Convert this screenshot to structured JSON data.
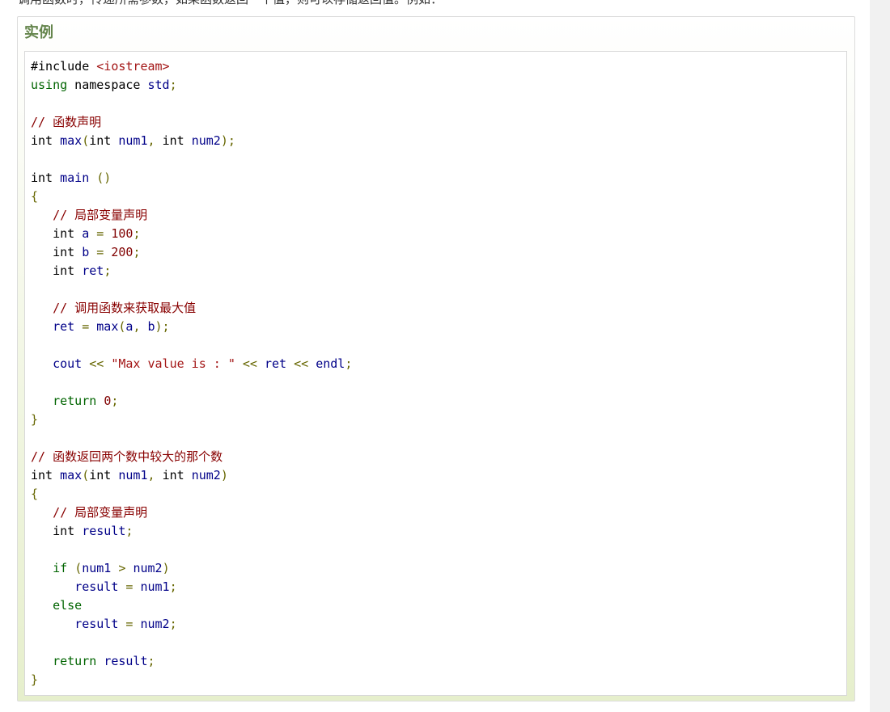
{
  "intro_text": "调用函数时，传递所需参数，如果函数返回一个值，则可以存储返回值。例如：",
  "example": {
    "title": "实例",
    "code_lines": [
      [
        {
          "t": "pre",
          "v": "#include "
        },
        {
          "t": "include",
          "v": "<iostream>"
        }
      ],
      [
        {
          "t": "keyword",
          "v": "using"
        },
        {
          "t": "plain",
          "v": " namespace "
        },
        {
          "t": "ident",
          "v": "std"
        },
        {
          "t": "punct",
          "v": ";"
        }
      ],
      [],
      [
        {
          "t": "comment",
          "v": "// 函数声明"
        }
      ],
      [
        {
          "t": "plain",
          "v": "int "
        },
        {
          "t": "ident",
          "v": "max"
        },
        {
          "t": "punct",
          "v": "("
        },
        {
          "t": "plain",
          "v": "int "
        },
        {
          "t": "ident",
          "v": "num1"
        },
        {
          "t": "punct",
          "v": ", "
        },
        {
          "t": "plain",
          "v": "int "
        },
        {
          "t": "ident",
          "v": "num2"
        },
        {
          "t": "punct",
          "v": ");"
        }
      ],
      [],
      [
        {
          "t": "plain",
          "v": "int "
        },
        {
          "t": "ident",
          "v": "main"
        },
        {
          "t": "plain",
          "v": " "
        },
        {
          "t": "punct",
          "v": "()"
        }
      ],
      [
        {
          "t": "punct",
          "v": "{"
        }
      ],
      [
        {
          "t": "plain",
          "v": "   "
        },
        {
          "t": "comment",
          "v": "// 局部变量声明"
        }
      ],
      [
        {
          "t": "plain",
          "v": "   int "
        },
        {
          "t": "ident",
          "v": "a"
        },
        {
          "t": "plain",
          "v": " "
        },
        {
          "t": "punct",
          "v": "="
        },
        {
          "t": "plain",
          "v": " "
        },
        {
          "t": "number",
          "v": "100"
        },
        {
          "t": "punct",
          "v": ";"
        }
      ],
      [
        {
          "t": "plain",
          "v": "   int "
        },
        {
          "t": "ident",
          "v": "b"
        },
        {
          "t": "plain",
          "v": " "
        },
        {
          "t": "punct",
          "v": "="
        },
        {
          "t": "plain",
          "v": " "
        },
        {
          "t": "number",
          "v": "200"
        },
        {
          "t": "punct",
          "v": ";"
        }
      ],
      [
        {
          "t": "plain",
          "v": "   int "
        },
        {
          "t": "ident",
          "v": "ret"
        },
        {
          "t": "punct",
          "v": ";"
        }
      ],
      [],
      [
        {
          "t": "plain",
          "v": "   "
        },
        {
          "t": "comment",
          "v": "// 调用函数来获取最大值"
        }
      ],
      [
        {
          "t": "plain",
          "v": "   "
        },
        {
          "t": "ident",
          "v": "ret"
        },
        {
          "t": "plain",
          "v": " "
        },
        {
          "t": "punct",
          "v": "="
        },
        {
          "t": "plain",
          "v": " "
        },
        {
          "t": "ident",
          "v": "max"
        },
        {
          "t": "punct",
          "v": "("
        },
        {
          "t": "ident",
          "v": "a"
        },
        {
          "t": "punct",
          "v": ", "
        },
        {
          "t": "ident",
          "v": "b"
        },
        {
          "t": "punct",
          "v": ");"
        }
      ],
      [],
      [
        {
          "t": "plain",
          "v": "   "
        },
        {
          "t": "ident",
          "v": "cout"
        },
        {
          "t": "plain",
          "v": " "
        },
        {
          "t": "punct",
          "v": "<<"
        },
        {
          "t": "plain",
          "v": " "
        },
        {
          "t": "string",
          "v": "\"Max value is : \""
        },
        {
          "t": "plain",
          "v": " "
        },
        {
          "t": "punct",
          "v": "<<"
        },
        {
          "t": "plain",
          "v": " "
        },
        {
          "t": "ident",
          "v": "ret"
        },
        {
          "t": "plain",
          "v": " "
        },
        {
          "t": "punct",
          "v": "<<"
        },
        {
          "t": "plain",
          "v": " "
        },
        {
          "t": "ident",
          "v": "endl"
        },
        {
          "t": "punct",
          "v": ";"
        }
      ],
      [],
      [
        {
          "t": "plain",
          "v": "   "
        },
        {
          "t": "keyword",
          "v": "return"
        },
        {
          "t": "plain",
          "v": " "
        },
        {
          "t": "number",
          "v": "0"
        },
        {
          "t": "punct",
          "v": ";"
        }
      ],
      [
        {
          "t": "punct",
          "v": "}"
        }
      ],
      [],
      [
        {
          "t": "comment",
          "v": "// 函数返回两个数中较大的那个数"
        }
      ],
      [
        {
          "t": "plain",
          "v": "int "
        },
        {
          "t": "ident",
          "v": "max"
        },
        {
          "t": "punct",
          "v": "("
        },
        {
          "t": "plain",
          "v": "int "
        },
        {
          "t": "ident",
          "v": "num1"
        },
        {
          "t": "punct",
          "v": ", "
        },
        {
          "t": "plain",
          "v": "int "
        },
        {
          "t": "ident",
          "v": "num2"
        },
        {
          "t": "punct",
          "v": ")"
        }
      ],
      [
        {
          "t": "punct",
          "v": "{"
        }
      ],
      [
        {
          "t": "plain",
          "v": "   "
        },
        {
          "t": "comment",
          "v": "// 局部变量声明"
        }
      ],
      [
        {
          "t": "plain",
          "v": "   int "
        },
        {
          "t": "ident",
          "v": "result"
        },
        {
          "t": "punct",
          "v": ";"
        }
      ],
      [],
      [
        {
          "t": "plain",
          "v": "   "
        },
        {
          "t": "keyword",
          "v": "if"
        },
        {
          "t": "plain",
          "v": " "
        },
        {
          "t": "punct",
          "v": "("
        },
        {
          "t": "ident",
          "v": "num1"
        },
        {
          "t": "plain",
          "v": " "
        },
        {
          "t": "punct",
          "v": ">"
        },
        {
          "t": "plain",
          "v": " "
        },
        {
          "t": "ident",
          "v": "num2"
        },
        {
          "t": "punct",
          "v": ")"
        }
      ],
      [
        {
          "t": "plain",
          "v": "      "
        },
        {
          "t": "ident",
          "v": "result"
        },
        {
          "t": "plain",
          "v": " "
        },
        {
          "t": "punct",
          "v": "="
        },
        {
          "t": "plain",
          "v": " "
        },
        {
          "t": "ident",
          "v": "num1"
        },
        {
          "t": "punct",
          "v": ";"
        }
      ],
      [
        {
          "t": "plain",
          "v": "   "
        },
        {
          "t": "keyword",
          "v": "else"
        }
      ],
      [
        {
          "t": "plain",
          "v": "      "
        },
        {
          "t": "ident",
          "v": "result"
        },
        {
          "t": "plain",
          "v": " "
        },
        {
          "t": "punct",
          "v": "="
        },
        {
          "t": "plain",
          "v": " "
        },
        {
          "t": "ident",
          "v": "num2"
        },
        {
          "t": "punct",
          "v": ";"
        }
      ],
      [],
      [
        {
          "t": "plain",
          "v": "   "
        },
        {
          "t": "keyword",
          "v": "return"
        },
        {
          "t": "plain",
          "v": " "
        },
        {
          "t": "ident",
          "v": "result"
        },
        {
          "t": "punct",
          "v": ";"
        }
      ],
      [
        {
          "t": "punct",
          "v": "}"
        }
      ]
    ]
  },
  "colors": {
    "title": "#64854c",
    "keyword": "#006400",
    "identifier": "#000088",
    "number": "#800000",
    "string": "#a31515",
    "comment": "#880000"
  }
}
